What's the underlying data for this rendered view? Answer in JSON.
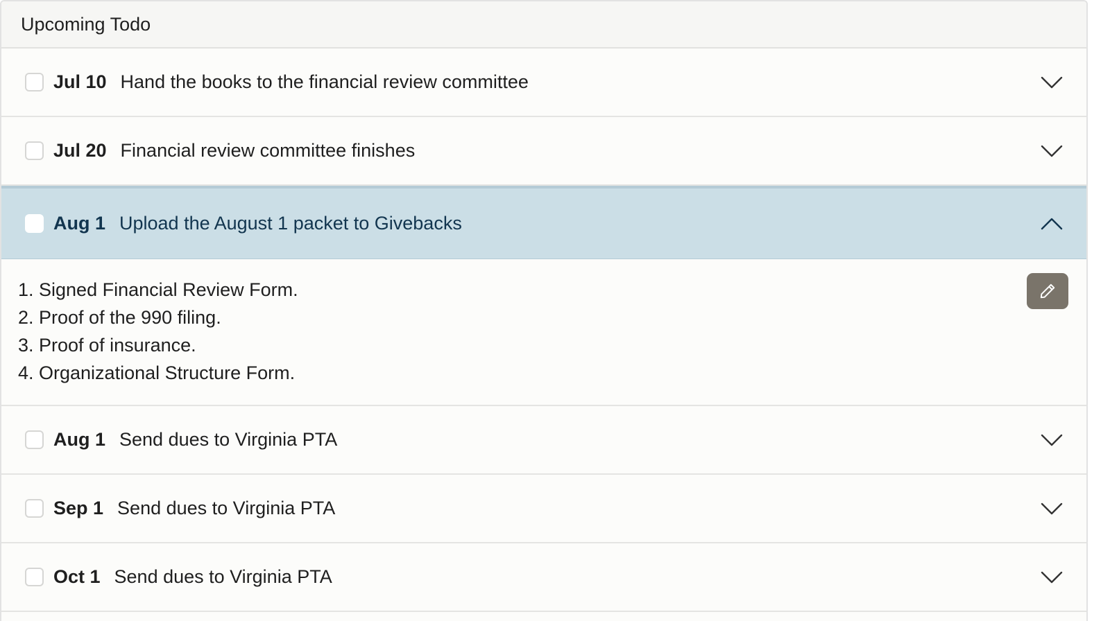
{
  "header": {
    "title": "Upcoming Todo"
  },
  "todos": [
    {
      "date": "Jul 10",
      "title": "Hand the books to the financial review committee"
    },
    {
      "date": "Jul 20",
      "title": "Financial review committee finishes"
    },
    {
      "date": "Aug 1",
      "title": "Upload the August 1 packet to Givebacks",
      "details": [
        "1. Signed Financial Review Form.",
        "2. Proof of the 990 filing.",
        "3. Proof of insurance.",
        "4. Organizational Structure Form."
      ]
    },
    {
      "date": "Aug 1",
      "title": "Send dues to Virginia PTA"
    },
    {
      "date": "Sep 1",
      "title": "Send dues to Virginia PTA"
    },
    {
      "date": "Oct 1",
      "title": "Send dues to Virginia PTA"
    }
  ],
  "colors": {
    "expanded_row": "#cbdee6",
    "expanded_text": "#12354f",
    "edit_button": "#7a746a"
  },
  "icons": {
    "collapsed": "chevron-down-icon",
    "expanded": "chevron-up-icon",
    "edit": "pencil-icon"
  }
}
